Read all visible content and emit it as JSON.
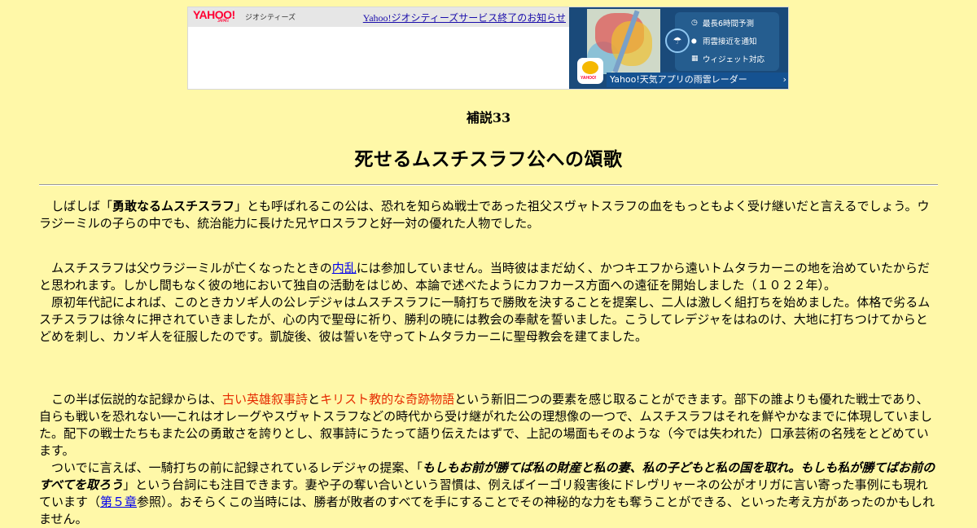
{
  "ad": {
    "logo_text": "YAHOO!",
    "logo_sub": "JAPAN",
    "brand": "ジオシティーズ",
    "notice_link": "Yahoo!ジオシティーズサービス終了のお知らせ",
    "app_icon_text": "YAHOO!",
    "features": [
      {
        "icon": "clock-icon",
        "glyph": "◷",
        "label": "最長6時間予測"
      },
      {
        "icon": "pin-icon",
        "glyph": "⬤",
        "label": "雨雲接近を通知"
      },
      {
        "icon": "widget-icon",
        "glyph": "▦",
        "label": "ウィジェット対応"
      }
    ],
    "cta": "Yahoo!天気アプリの雨雲レーダー",
    "cta_arrow": "›"
  },
  "page": {
    "supplement": "補説33",
    "title": "死せるムスチスラフ公への頌歌"
  },
  "p1": {
    "a": "しばしば「",
    "b": "勇敢なるムスチスラフ",
    "c": "」とも呼ばれるこの公は、恐れを知らぬ戦士であった祖父スヴャトスラフの血をもっともよく受け継いだと言えるでしょう。ウラジーミルの子らの中でも、統治能力に長けた兄ヤロスラフと好一対の優れた人物でした。"
  },
  "p2": {
    "a": "ムスチスラフは父ウラジーミルが亡くなったときの",
    "link": "内乱",
    "b": "には参加していません。当時彼はまだ幼く、かつキエフから遠いトムタラカーニの地を治めていたからだと思われます。しかし間もなく彼の地において独自の活動をはじめ、本論で述べたようにカフカース方面への遠征を開始しました（１０２２年）。",
    "c": "原初年代記によれば、このときカソギ人の公レデジャはムスチスラフに一騎打ちで勝敗を決することを提案し、二人は激しく組打ちを始めました。体格で劣るムスチスラフは徐々に押されていきましたが、心の内で聖母に祈り、勝利の暁には教会の奉献を誓いました。こうしてレデジャをはねのけ、大地に打ちつけてからとどめを刺し、カソギ人を征服したのです。凱旋後、彼は誓いを守ってトムタラカーニに聖母教会を建てました。"
  },
  "p3": {
    "a": "この半ば伝説的な記録からは、",
    "red1": "古い英雄叙事詩",
    "b": "と",
    "red2": "キリスト教的な奇跡物語",
    "c": "という新旧二つの要素を感じ取ることができます。部下の誰よりも優れた戦士であり、自らも戦いを恐れない──これはオレーグやスヴャトスラフなどの時代から受け継がれた公の理想像の一つで、ムスチスラフはそれを鮮やかなまでに体現していました。配下の戦士たちもまた公の勇敢さを誇りとし、叙事詩にうたって語り伝えたはずで、上記の場面もそのような（今では失われた）口承芸術の名残をとどめています。",
    "d": "ついでに言えば、一騎打ちの前に記録されているレデジャの提案、「",
    "quote": "もしもお前が勝てば私の財産と私の妻、私の子どもと私の国を取れ。もしも私が勝てばお前のすべてを取ろう",
    "e": "」という台詞にも注目できます。妻や子の奪い合いという習慣は、例えばイーゴリ殺害後にドレヴリャーネの公がオリガに言い寄った事例にも現れています（",
    "link": "第５章",
    "f": "参照）。おそらくこの当時には、勝者が敗者のすべてを手にすることでその神秘的な力をも奪うことができる、といった考え方があったのかもしれません。"
  }
}
